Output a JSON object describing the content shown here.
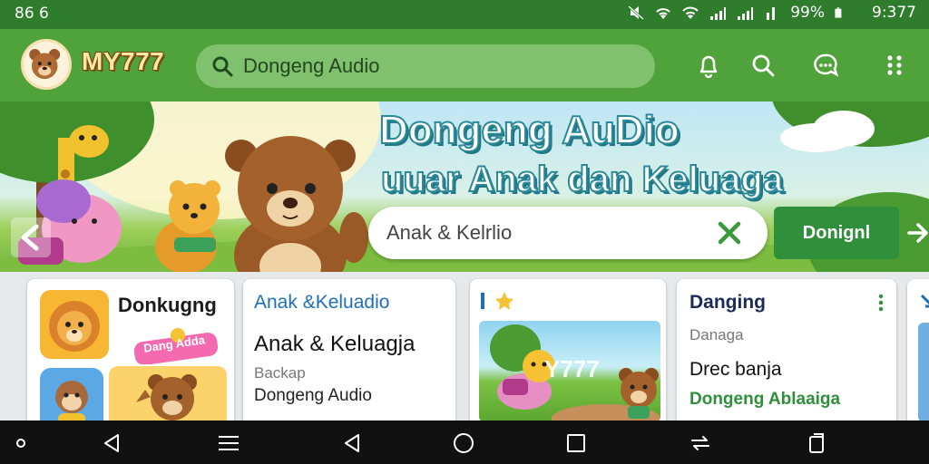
{
  "status_bar": {
    "left_text": "86 6",
    "battery_text": "99%",
    "time": "9:377",
    "icons": [
      "mute-icon",
      "wifi-icon",
      "wifi-icon",
      "signal-icon",
      "signal-icon",
      "signal-icon",
      "battery-icon"
    ]
  },
  "app_bar": {
    "brand": "MY777",
    "search_text": "Dongeng Audio",
    "actions": [
      "bell-icon",
      "search-icon",
      "chat-icon",
      "more-vert-icon"
    ]
  },
  "banner": {
    "title": "Dongeng AuDio",
    "subtitle": "uuar Anak dan Keluaga",
    "search_value": "Anak & Kelrlio",
    "button_label": "Donignl"
  },
  "cards": {
    "card1": {
      "title": "Donkugng",
      "tag": "Dang Adda"
    },
    "card2": {
      "header": "Anak &Keluadio",
      "title": "Anak & Keluagja",
      "sub1": "Backap",
      "sub2": "Dongeng Audio"
    },
    "card3": {
      "watermark": "Y777"
    },
    "card4": {
      "title": "Danging",
      "sub1": "Danaga",
      "sub2": "Drec banja",
      "sub3": "Dongeng Ablaaiga"
    }
  },
  "nav_bar": {
    "icons": [
      "dot-icon",
      "back-icon",
      "menu-icon",
      "back-icon",
      "home-icon",
      "recents-icon",
      "rotate-icon",
      "screenshot-icon"
    ]
  },
  "colors": {
    "status_bar": "#2f7d2c",
    "app_bar": "#4fa33a",
    "search_field": "#7fc16c",
    "accent_green": "#2f8f3a",
    "link_blue": "#1f6fb8"
  }
}
